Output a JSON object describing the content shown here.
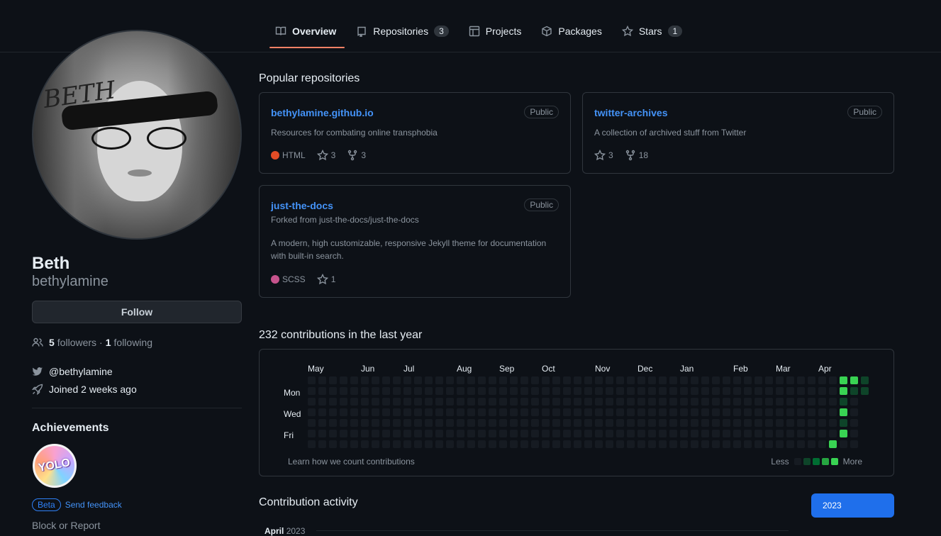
{
  "nav": {
    "tabs": [
      {
        "label": "Overview",
        "count": null,
        "icon": "book-icon"
      },
      {
        "label": "Repositories",
        "count": "3",
        "icon": "repo-icon"
      },
      {
        "label": "Projects",
        "count": null,
        "icon": "table-icon"
      },
      {
        "label": "Packages",
        "count": null,
        "icon": "package-icon"
      },
      {
        "label": "Stars",
        "count": "1",
        "icon": "star-icon"
      }
    ]
  },
  "profile": {
    "full_name": "Beth",
    "username": "bethylamine",
    "follow_label": "Follow",
    "followers_count": "5",
    "followers_label": "followers",
    "following_count": "1",
    "following_label": "following",
    "separator": "·",
    "twitter": "@bethylamine",
    "joined": "Joined 2 weeks ago",
    "avatar_text": "BETH"
  },
  "achievements": {
    "title": "Achievements",
    "badge_text": "YOLO",
    "beta_label": "Beta",
    "feedback_label": "Send feedback"
  },
  "block_report": "Block or Report",
  "popular": {
    "title": "Popular repositories",
    "repos": [
      {
        "name": "bethylamine.github.io",
        "visibility": "Public",
        "forked_from": "",
        "description": "Resources for combating online transphobia",
        "language": "HTML",
        "language_color": "#e34c26",
        "stars": "3",
        "forks": "3"
      },
      {
        "name": "twitter-archives",
        "visibility": "Public",
        "forked_from": "",
        "description": "A collection of archived stuff from Twitter",
        "language": "",
        "language_color": "",
        "stars": "3",
        "forks": "18"
      },
      {
        "name": "just-the-docs",
        "visibility": "Public",
        "forked_from": "Forked from just-the-docs/just-the-docs",
        "description_line1": "A modern, high customizable, responsive Jekyll theme for documentation",
        "description_line2": "with built-in search.",
        "language": "SCSS",
        "language_color": "#c6538c",
        "stars": "1",
        "forks": ""
      }
    ]
  },
  "contributions": {
    "title": "232 contributions in the last year",
    "months": [
      "May",
      "Jun",
      "Jul",
      "Aug",
      "Sep",
      "Oct",
      "Nov",
      "Dec",
      "Jan",
      "Feb",
      "Mar",
      "Apr"
    ],
    "days": [
      "Mon",
      "Wed",
      "Fri"
    ],
    "learn_link": "Learn how we count contributions",
    "legend_less": "Less",
    "legend_more": "More",
    "colors": [
      "#161b22",
      "#0e4429",
      "#006d32",
      "#26a641",
      "#39d353"
    ]
  },
  "activity": {
    "title": "Contribution activity",
    "year": "2023",
    "month_label": "April",
    "month_year": "2023"
  }
}
